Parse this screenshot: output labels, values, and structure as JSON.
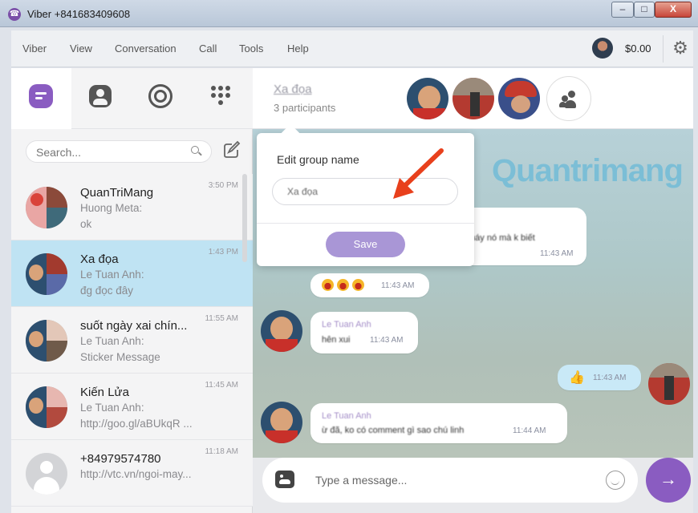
{
  "window": {
    "title": "Viber +841683409608",
    "min_glyph": "–",
    "max_glyph": "□",
    "close_glyph": "X"
  },
  "menu": {
    "items": [
      "Viber",
      "View",
      "Conversation",
      "Call",
      "Tools",
      "Help"
    ],
    "balance": "$0.00",
    "settings_glyph": "⚙"
  },
  "search": {
    "placeholder": "Search..."
  },
  "compose_glyph": "☐",
  "conversations": [
    {
      "name": "QuanTriMang",
      "sub1": "Huong Meta:",
      "sub2": "ok",
      "time": "3:50 PM",
      "selected": false
    },
    {
      "name": "Xa đọa",
      "sub1": "Le Tuan Anh:",
      "sub2": "đg đọc đây",
      "time": "1:43 PM",
      "selected": true
    },
    {
      "name": "suốt ngày xai chín...",
      "sub1": "Le Tuan Anh:",
      "sub2": "Sticker Message",
      "time": "11:55 AM",
      "selected": false
    },
    {
      "name": "Kiến Lửa",
      "sub1": "Le Tuan Anh:",
      "sub2": "http://goo.gl/aBUkqR ...",
      "time": "11:45 AM",
      "selected": false
    },
    {
      "name": "+84979574780",
      "sub1": "http://vtc.vn/ngoi-may...",
      "sub2": "",
      "time": "11:18 AM",
      "selected": false
    }
  ],
  "header": {
    "group_name": "Xa đọa",
    "participants": "3 participants"
  },
  "watermark": "Quantrimang",
  "messages": {
    "m1": {
      "text": "máy nó mà k biết",
      "time": "11:43 AM"
    },
    "m2": {
      "time": "11:43 AM"
    },
    "m3": {
      "sender": "Le Tuan Anh",
      "text": "hên xui",
      "time": "11:43 AM"
    },
    "m4": {
      "time": "11:43 AM"
    },
    "m5": {
      "sender": "Le Tuan Anh",
      "text": "ừ đã, ko có comment gì sao chú linh",
      "time": "11:44 AM"
    }
  },
  "popup": {
    "title": "Edit group name",
    "value": "Xa đọa",
    "save_label": "Save"
  },
  "composer": {
    "placeholder": "Type a message...",
    "send_glyph": "→"
  },
  "colors": {
    "accent": "#8a5cc1",
    "selected_row": "#bfe3f3",
    "arrow": "#e8401c"
  }
}
